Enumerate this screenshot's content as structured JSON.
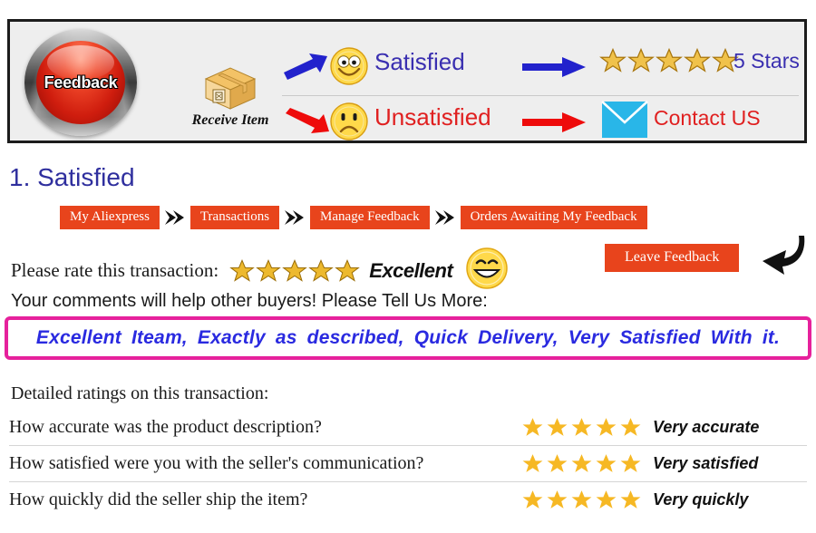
{
  "banner": {
    "feedback_button_label": "Feedback",
    "receive_item_label": "Receive Item",
    "satisfied_label": "Satisfied",
    "unsatisfied_label": "Unsatisfied",
    "five_stars_label": "5 Stars",
    "contact_label": "Contact US",
    "star_count": 5,
    "colors": {
      "satisfied_text": "#3a2fb0",
      "unsatisfied_text": "#e02020",
      "blue_arrow": "#2222cc",
      "red_arrow": "#ee0b0b",
      "mail_icon": "#29b6e8",
      "banner_bg": "#eeeeee",
      "banner_border": "#1c1c1c"
    }
  },
  "section": {
    "title": "1. Satisfied"
  },
  "breadcrumb": {
    "color": "#e8441c",
    "items": [
      {
        "label": "My Aliexpress"
      },
      {
        "label": "Transactions"
      },
      {
        "label": "Manage Feedback"
      },
      {
        "label": "Orders Awaiting My Feedback"
      }
    ]
  },
  "rating": {
    "prompt": "Please rate this transaction:",
    "stars": 5,
    "value_label": "Excellent",
    "leave_feedback_label": "Leave Feedback"
  },
  "comments": {
    "prompt": "Your comments will help other buyers! Please Tell Us More:",
    "text": "Excellent Iteam, Exactly as described, Quick Delivery, Very Satisfied With it.",
    "border_color": "#e6219c",
    "text_color": "#2a2ae0"
  },
  "detailed_ratings": {
    "title": "Detailed ratings on this transaction:",
    "star_color": "#f6b824",
    "rows": [
      {
        "question": "How accurate was the product description?",
        "stars": 5,
        "answer": "Very accurate"
      },
      {
        "question": "How satisfied were you with the seller's communication?",
        "stars": 5,
        "answer": "Very satisfied"
      },
      {
        "question": "How quickly did the seller ship the item?",
        "stars": 5,
        "answer": "Very quickly"
      }
    ]
  }
}
